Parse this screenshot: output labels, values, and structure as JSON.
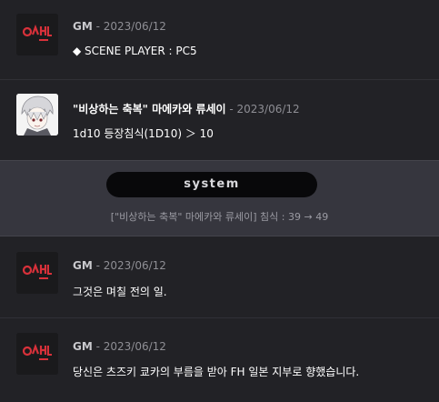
{
  "messages": [
    {
      "sender": "GM",
      "date": " - 2023/06/12",
      "text": "◆ SCENE PLAYER : PC5",
      "avatar": "gm-logo-icon"
    },
    {
      "sender": "\"비상하는 축복\" 마에카와 류세이",
      "date": " - 2023/06/12",
      "text": "1d10 등장침식(1D10) ＞ 10",
      "avatar": "character-portrait"
    },
    {
      "sender": "GM",
      "date": " - 2023/06/12",
      "text": "그것은 며칠 전의 일.",
      "avatar": "gm-logo-icon"
    },
    {
      "sender": "GM",
      "date": " - 2023/06/12",
      "text": "당신은 츠즈키 쿄카의 부름을 받아 FH 일본 지부로 향했습니다.",
      "avatar": "gm-logo-icon"
    }
  ],
  "system": {
    "label": "system",
    "text": "[\"비상하는 축복\" 마에카와 류세이] 침식 : 39 → 49"
  },
  "colors": {
    "background": "#222226",
    "system_background": "#36363e",
    "logo_red": "#d8313a"
  }
}
